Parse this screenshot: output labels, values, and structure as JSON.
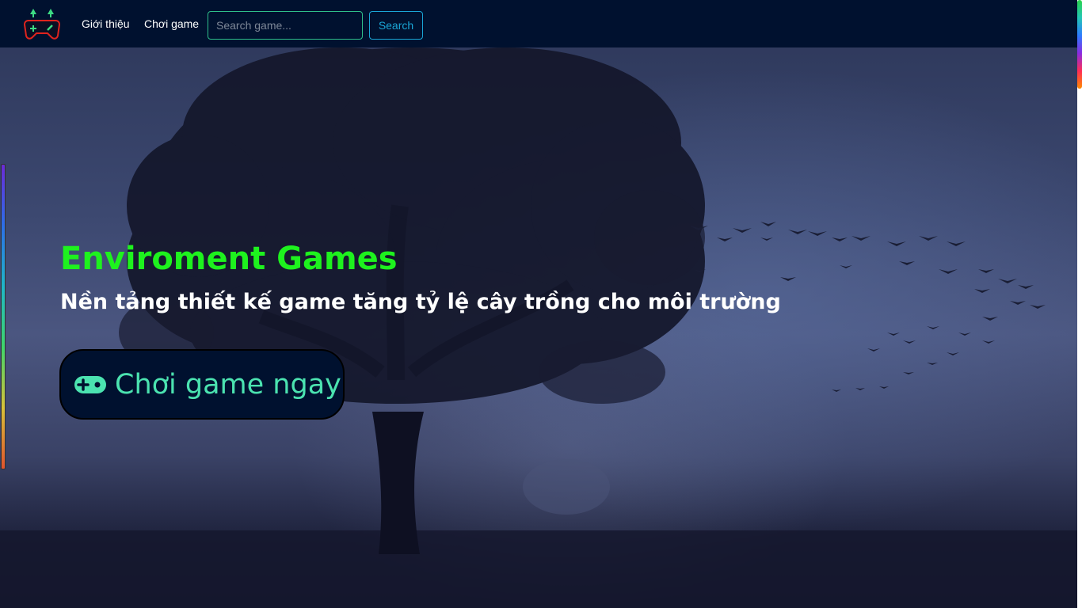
{
  "navbar": {
    "logo_icon": "gamepad-trees-logo-icon",
    "links": [
      {
        "label": "Giới thiệu"
      },
      {
        "label": "Chơi game"
      }
    ],
    "search": {
      "placeholder": "Search game...",
      "value": "",
      "button_label": "Search"
    }
  },
  "hero": {
    "title": "Enviroment Games",
    "subtitle": "Nền tảng thiết kế game tăng tỷ lệ cây trồng cho môi trường",
    "cta_label": "Chơi game ngay",
    "cta_icon": "gamepad-icon"
  },
  "background": {
    "scene": "tree-silhouette-with-flying-birds-foggy-night"
  },
  "colors": {
    "navbar_bg": "#00112f",
    "title_green": "#1ef21e",
    "cta_text": "#4be3b0",
    "search_border": "#2ebf8a",
    "search_button": "#1aa6d6"
  }
}
